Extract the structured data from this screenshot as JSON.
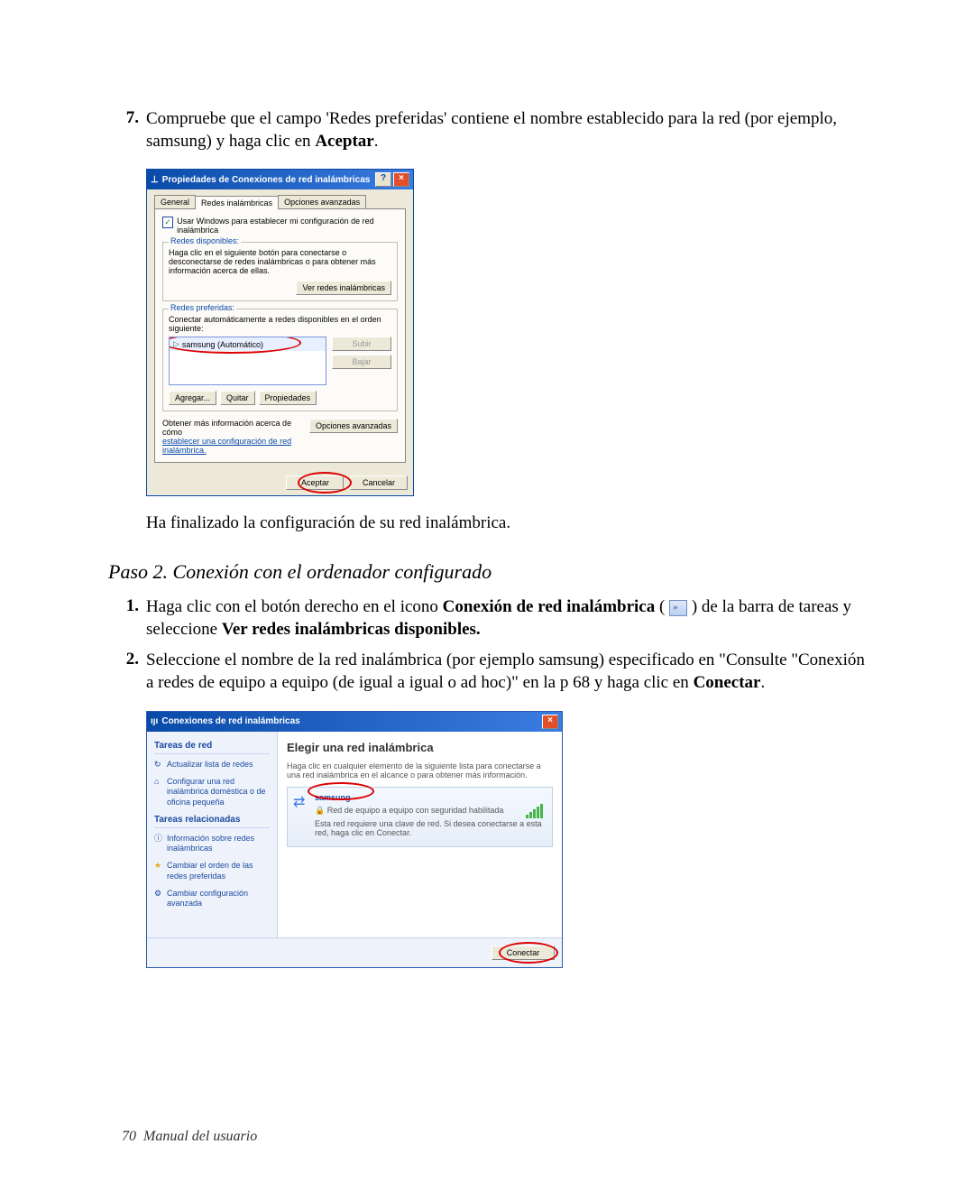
{
  "step7": {
    "num": "7.",
    "text_a": "Compruebe que el campo 'Redes preferidas' contiene el nombre establecido para la red (por ejemplo, samsung) y haga clic en ",
    "text_b": "Aceptar",
    "text_c": "."
  },
  "dlg1": {
    "title": "Propiedades de Conexiones de red inalámbricas",
    "help": "?",
    "close": "×",
    "tabs": {
      "general": "General",
      "wireless": "Redes inalámbricas",
      "advanced": "Opciones avanzadas"
    },
    "use_windows": "Usar Windows para establecer mi configuración de red inalámbrica",
    "group_available": {
      "title": "Redes disponibles:",
      "desc": "Haga clic en el siguiente botón para conectarse o desconectarse de redes inalámbricas o para obtener más información acerca de ellas.",
      "btn": "Ver redes inalámbricas"
    },
    "group_preferred": {
      "title": "Redes preferidas:",
      "desc": "Conectar automáticamente a redes disponibles en el orden siguiente:",
      "item": "samsung (Automático)",
      "up": "Subir",
      "down": "Bajar",
      "add": "Agregar...",
      "remove": "Quitar",
      "props": "Propiedades"
    },
    "more_info": "Obtener más información acerca de cómo",
    "more_link": "establecer una configuración de red inalámbrica.",
    "adv_opts": "Opciones avanzadas",
    "ok": "Aceptar",
    "cancel": "Cancelar"
  },
  "post_text": "Ha finalizado la configuración de su red inalámbrica.",
  "section_h": "Paso 2. Conexión con el ordenador configurado",
  "step1": {
    "num": "1.",
    "a": "Haga clic con el botón derecho en el icono ",
    "b": "Conexión de red inalámbrica",
    "c": " ( ",
    "d": " ) de la barra de tareas y seleccione ",
    "e": "Ver redes inalámbricas disponibles."
  },
  "step2": {
    "num": "2.",
    "a": "Seleccione el nombre de la red inalámbrica (por ejemplo samsung) especificado en \"Consulte \"Conexión a redes de equipo a equipo (de igual a igual o ad hoc)\" en la p 68 y haga clic en ",
    "b": "Conectar",
    "c": "."
  },
  "dlg2": {
    "title": "Conexiones de red inalámbricas",
    "close": "×",
    "side": {
      "h1": "Tareas de red",
      "l1": "Actualizar lista de redes",
      "l2": "Configurar una red inalámbrica doméstica o de oficina pequeña",
      "h2": "Tareas relacionadas",
      "l3": "Información sobre redes inalámbricas",
      "l4": "Cambiar el orden de las redes preferidas",
      "l5": "Cambiar configuración avanzada"
    },
    "main": {
      "h": "Elegir una red inalámbrica",
      "sub": "Haga clic en cualquier elemento de la siguiente lista para conectarse a una red inalámbrica en el alcance o para obtener más información.",
      "net_name": "samsung",
      "net_type": "Red de equipo a equipo con seguridad habilitada",
      "net_msg": "Esta red requiere una clave de red. Si desea conectarse a esta red, haga clic en Conectar."
    },
    "connect": "Conectar"
  },
  "footer": {
    "page": "70",
    "label": "Manual del usuario"
  }
}
